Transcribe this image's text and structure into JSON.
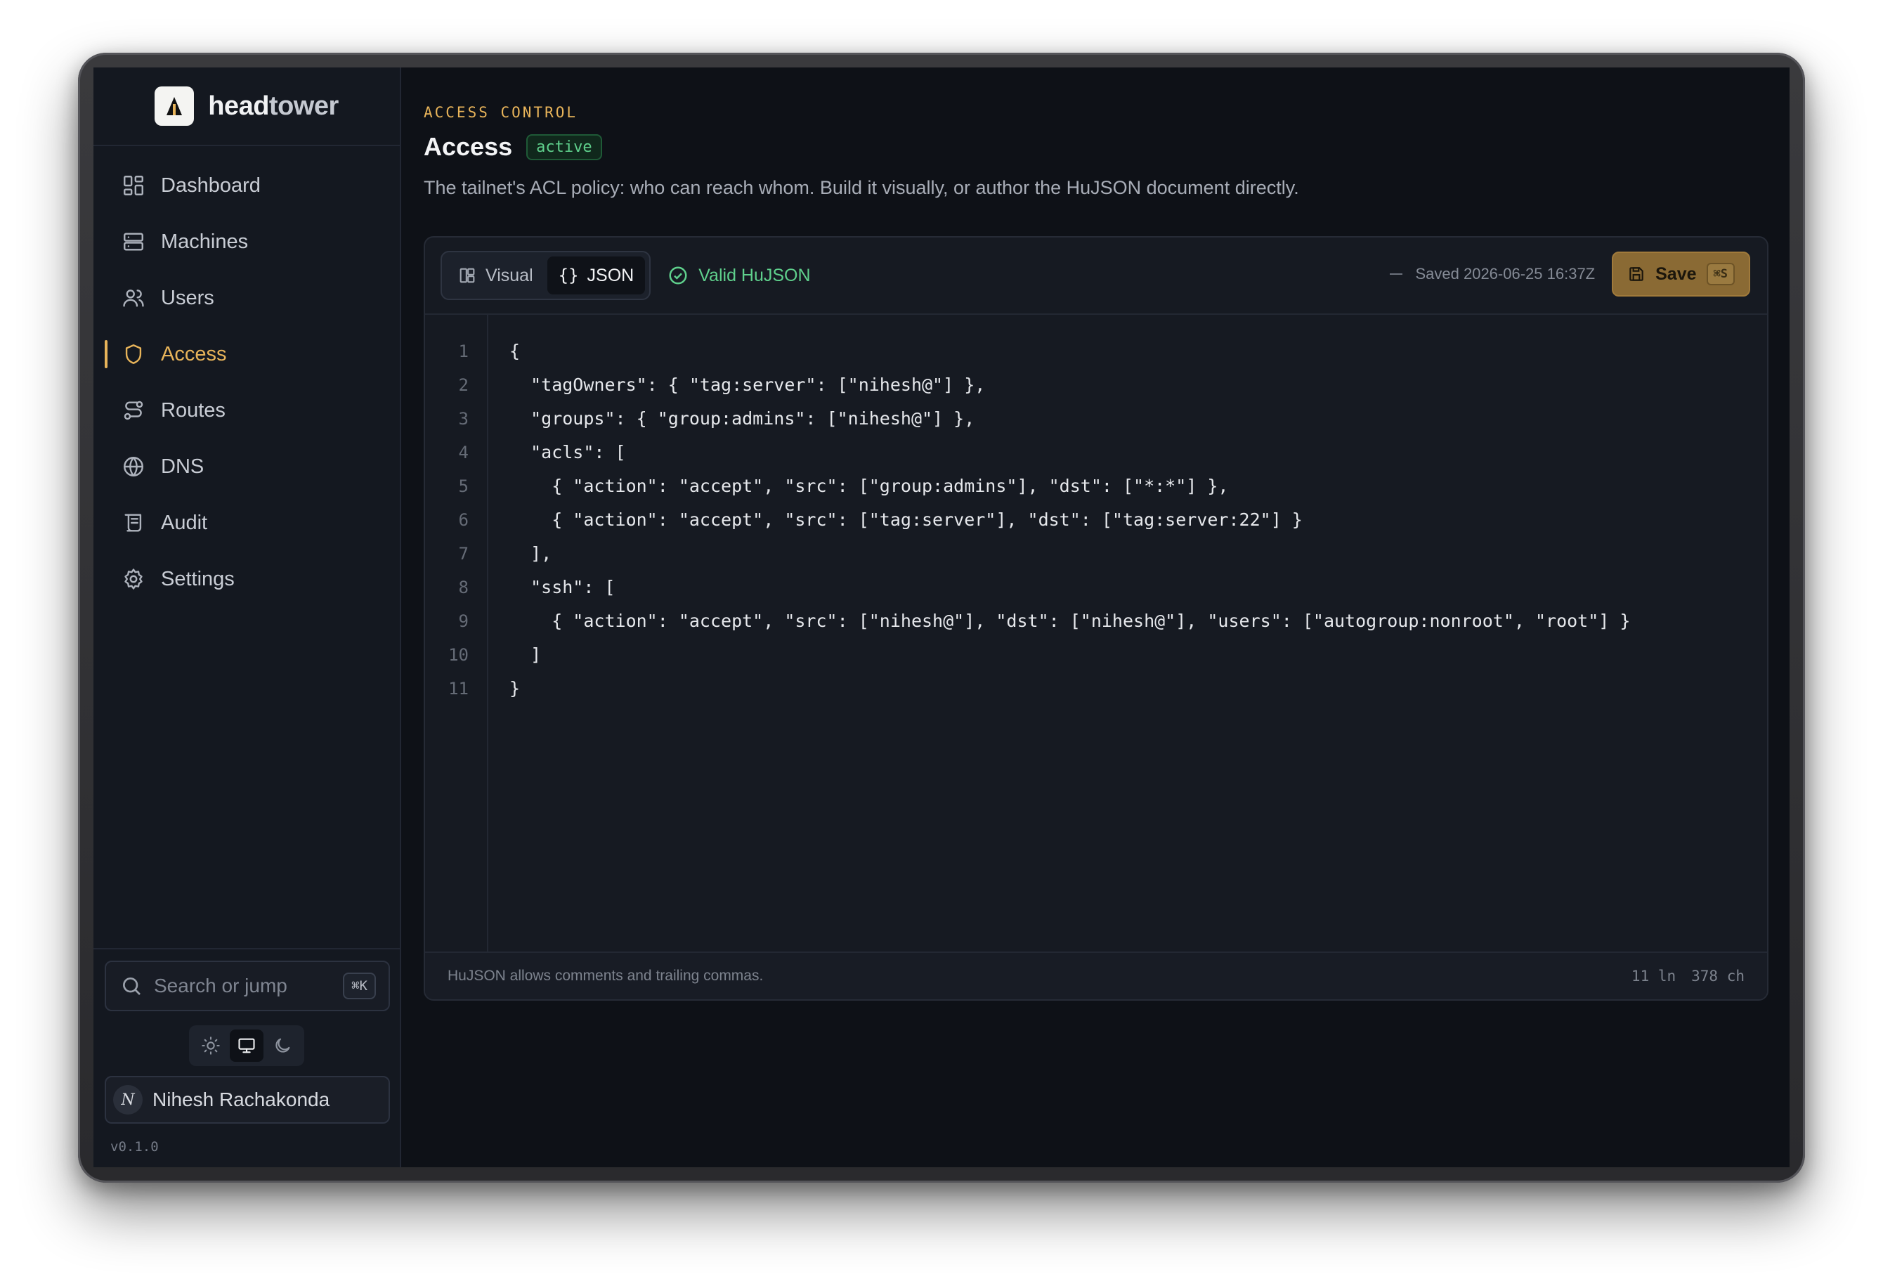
{
  "app": {
    "brand_bold": "head",
    "brand_light": "tower",
    "version": "v0.1.0"
  },
  "sidebar": {
    "items": [
      {
        "label": "Dashboard",
        "icon": "dashboard-icon"
      },
      {
        "label": "Machines",
        "icon": "server-icon"
      },
      {
        "label": "Users",
        "icon": "users-icon"
      },
      {
        "label": "Access",
        "icon": "shield-icon",
        "active": true
      },
      {
        "label": "Routes",
        "icon": "route-icon"
      },
      {
        "label": "DNS",
        "icon": "globe-icon"
      },
      {
        "label": "Audit",
        "icon": "scroll-icon"
      },
      {
        "label": "Settings",
        "icon": "gear-icon"
      }
    ],
    "search_placeholder": "Search or jump",
    "search_shortcut": "⌘K",
    "theme_options": [
      "light",
      "system",
      "dark"
    ],
    "theme_selected": "system",
    "user_initial": "N",
    "user_name": "Nihesh Rachakonda"
  },
  "page": {
    "eyebrow": "ACCESS CONTROL",
    "title": "Access",
    "status_badge": "active",
    "description": "The tailnet's ACL policy: who can reach whom. Build it visually, or author the HuJSON document directly."
  },
  "editor": {
    "tabs": [
      {
        "label": "Visual",
        "icon": "layout-icon"
      },
      {
        "label": "JSON",
        "icon": "braces-icon",
        "selected": true
      }
    ],
    "json_tab_glyph": "{}",
    "validation": "Valid HuJSON",
    "saved_text": "Saved 2026-06-25 16:37Z",
    "save_label": "Save",
    "save_shortcut": "⌘S",
    "line_numbers": [
      "1",
      "2",
      "3",
      "4",
      "5",
      "6",
      "7",
      "8",
      "9",
      "10",
      "11"
    ],
    "lines": [
      "{",
      "  \"tagOwners\": { \"tag:server\": [\"nihesh@\"] },",
      "  \"groups\": { \"group:admins\": [\"nihesh@\"] },",
      "  \"acls\": [",
      "    { \"action\": \"accept\", \"src\": [\"group:admins\"], \"dst\": [\"*:*\"] },",
      "    { \"action\": \"accept\", \"src\": [\"tag:server\"], \"dst\": [\"tag:server:22\"] }",
      "  ],",
      "  \"ssh\": [",
      "    { \"action\": \"accept\", \"src\": [\"nihesh@\"], \"dst\": [\"nihesh@\"], \"users\": [\"autogroup:nonroot\", \"root\"] }",
      "  ]",
      "}"
    ],
    "footer_note": "HuJSON allows comments and trailing commas.",
    "line_count": "11 ln",
    "char_count": "378 ch"
  },
  "colors": {
    "accent": "#e8b45a",
    "success": "#5fd08c",
    "background": "#0e1117",
    "sidebar": "#141820"
  }
}
